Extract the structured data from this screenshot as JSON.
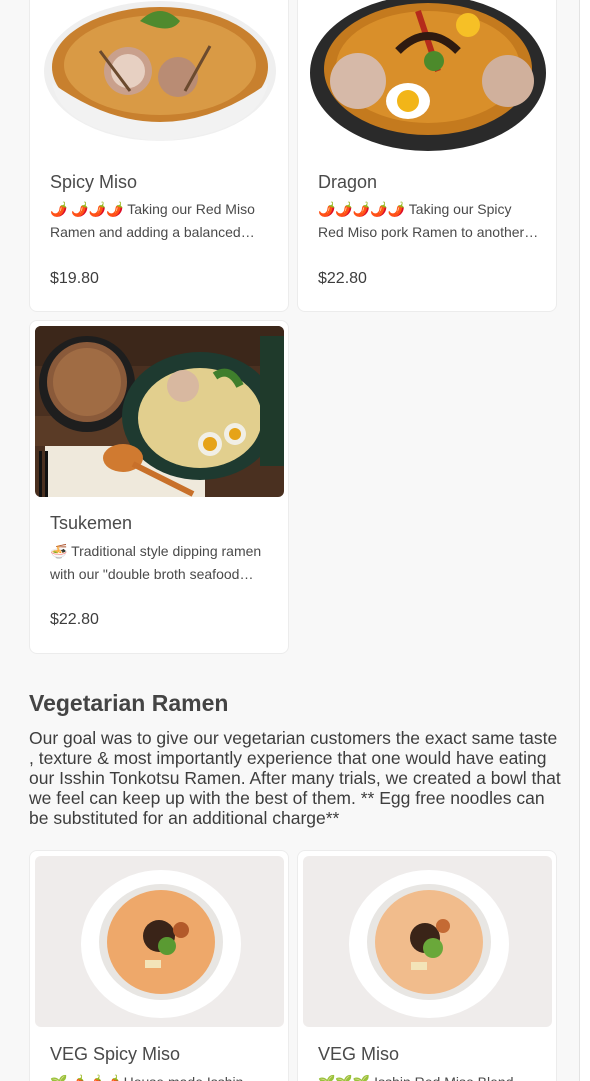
{
  "menu": {
    "items_top": [
      {
        "name": "Spicy Miso",
        "description": "🌶️ 🌶️🌶️🌶️ Taking our Red Miso Ramen and adding a balanced amount of spice.",
        "price": "$19.80"
      },
      {
        "name": "Dragon",
        "description": "🌶️🌶️🌶️🌶️🌶️ Taking our Spicy Red Miso pork Ramen to another level of heat.",
        "price": "$22.80"
      },
      {
        "name": "Tsukemen",
        "description": "🍜 Traditional style dipping ramen with our \"double broth seafood tonkotsu\".",
        "price": "$22.80"
      }
    ]
  },
  "vegetarian": {
    "title": "Vegetarian Ramen",
    "description": "Our goal was to give our vegetarian customers the exact same taste , texture & most importantly experience that one would have eating our Isshin Tonkotsu Ramen. After many trials, we created a bowl that we feel can keep up with the best of them. ** Egg free noodles can be substituted for an additional charge**",
    "items": [
      {
        "name": "VEG Spicy Miso",
        "description": "🌱🌶️🌶️🌶️ House made Isshin vegetarian spicy miso ramen."
      },
      {
        "name": "VEG Miso",
        "description": "🌱🌱🌱 Isshin Red Miso Blend vegetarian ramen."
      }
    ]
  }
}
